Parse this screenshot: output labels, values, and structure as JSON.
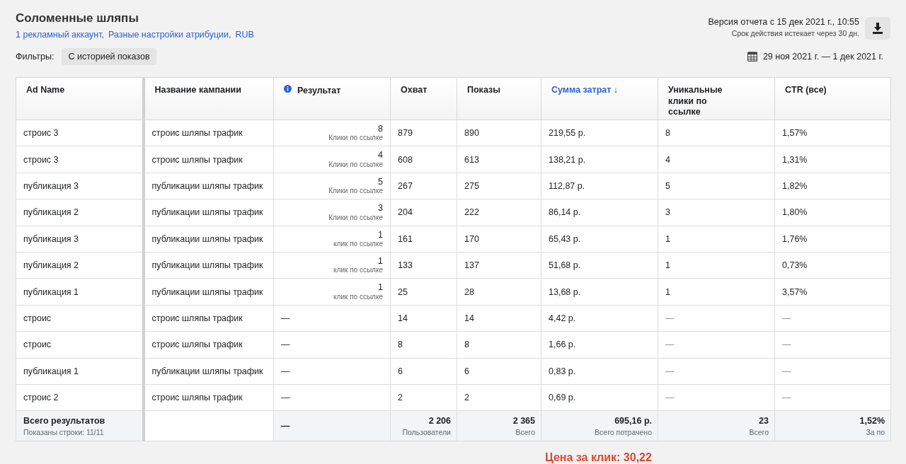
{
  "header": {
    "title": "Соломенные шляпы",
    "links": [
      "1 рекламный аккаунт,",
      "Разные настройки атрибуции,",
      "RUB"
    ],
    "version": "Версия отчета с 15 дек 2021 г., 10:55",
    "expiry": "Срок действия истекает через 30 дн."
  },
  "filters": {
    "label": "Фильтры:",
    "chips": [
      "С историей показов"
    ]
  },
  "date_range": "29 ноя 2021 г. — 1 дек 2021 г.",
  "table": {
    "columns": [
      {
        "label": "Ad Name",
        "sorted": false,
        "info": false
      },
      {
        "label": "Название кампании",
        "sorted": false,
        "info": false
      },
      {
        "label": "Результат",
        "sorted": false,
        "info": true
      },
      {
        "label": "Охват",
        "sorted": false,
        "info": false
      },
      {
        "label": "Показы",
        "sorted": false,
        "info": false
      },
      {
        "label": "Сумма затрат ↓",
        "sorted": true,
        "info": false
      },
      {
        "label": "Уникальные клики по ссылке",
        "sorted": false,
        "info": false
      },
      {
        "label": "CTR (все)",
        "sorted": false,
        "info": false
      }
    ],
    "rows": [
      {
        "ad": "строис 3",
        "campaign": "строис шляпы трафик",
        "result": "8",
        "result_label": "Клики по ссылке",
        "reach": "879",
        "impressions": "890",
        "spend": "219,55 р.",
        "unique": "8",
        "ctr": "1,57%"
      },
      {
        "ad": "строис 3",
        "campaign": "строис шляпы трафик",
        "result": "4",
        "result_label": "Клики по ссылке",
        "reach": "608",
        "impressions": "613",
        "spend": "138,21 р.",
        "unique": "4",
        "ctr": "1,31%"
      },
      {
        "ad": "публикация 3",
        "campaign": "публикации шляпы трафик",
        "result": "5",
        "result_label": "Клики по ссылке",
        "reach": "267",
        "impressions": "275",
        "spend": "112,87 р.",
        "unique": "5",
        "ctr": "1,82%"
      },
      {
        "ad": "публикация 2",
        "campaign": "публикации шляпы трафик",
        "result": "3",
        "result_label": "Клики по ссылке",
        "reach": "204",
        "impressions": "222",
        "spend": "86,14 р.",
        "unique": "3",
        "ctr": "1,80%"
      },
      {
        "ad": "публикация 3",
        "campaign": "публикации шляпы трафик",
        "result": "1",
        "result_label": "клик по ссылке",
        "reach": "161",
        "impressions": "170",
        "spend": "65,43 р.",
        "unique": "1",
        "ctr": "1,76%"
      },
      {
        "ad": "публикация 2",
        "campaign": "публикации шляпы трафик",
        "result": "1",
        "result_label": "клик по ссылке",
        "reach": "133",
        "impressions": "137",
        "spend": "51,68 р.",
        "unique": "1",
        "ctr": "0,73%"
      },
      {
        "ad": "публикация 1",
        "campaign": "публикации шляпы трафик",
        "result": "1",
        "result_label": "клик по ссылке",
        "reach": "25",
        "impressions": "28",
        "spend": "13,68 р.",
        "unique": "1",
        "ctr": "3,57%"
      },
      {
        "ad": "строис",
        "campaign": "строис шляпы трафик",
        "result": "—",
        "reach": "14",
        "impressions": "14",
        "spend": "4,42 р.",
        "unique": "—",
        "ctr": "—"
      },
      {
        "ad": "строис",
        "campaign": "строис шляпы трафик",
        "result": "—",
        "reach": "8",
        "impressions": "8",
        "spend": "1,66 р.",
        "unique": "—",
        "ctr": "—"
      },
      {
        "ad": "публикация 1",
        "campaign": "публикации шляпы трафик",
        "result": "—",
        "reach": "6",
        "impressions": "6",
        "spend": "0,83 р.",
        "unique": "—",
        "ctr": "—"
      },
      {
        "ad": "строис 2",
        "campaign": "строис шляпы трафик",
        "result": "—",
        "reach": "2",
        "impressions": "2",
        "spend": "0,69 р.",
        "unique": "—",
        "ctr": "—"
      }
    ],
    "totals": {
      "title": "Всего результатов",
      "subtitle": "Показаны строки: 11/11",
      "result": "—",
      "cells": [
        {
          "value": "2 206",
          "label": "Пользователи"
        },
        {
          "value": "2 365",
          "label": "Всего"
        },
        {
          "value": "695,16 р.",
          "label": "Всего потрачено"
        },
        {
          "value": "23",
          "label": "Всего"
        },
        {
          "value": "1,52%",
          "label": "За по"
        }
      ]
    }
  },
  "cost_per_click": "Цена за клик: 30,22"
}
